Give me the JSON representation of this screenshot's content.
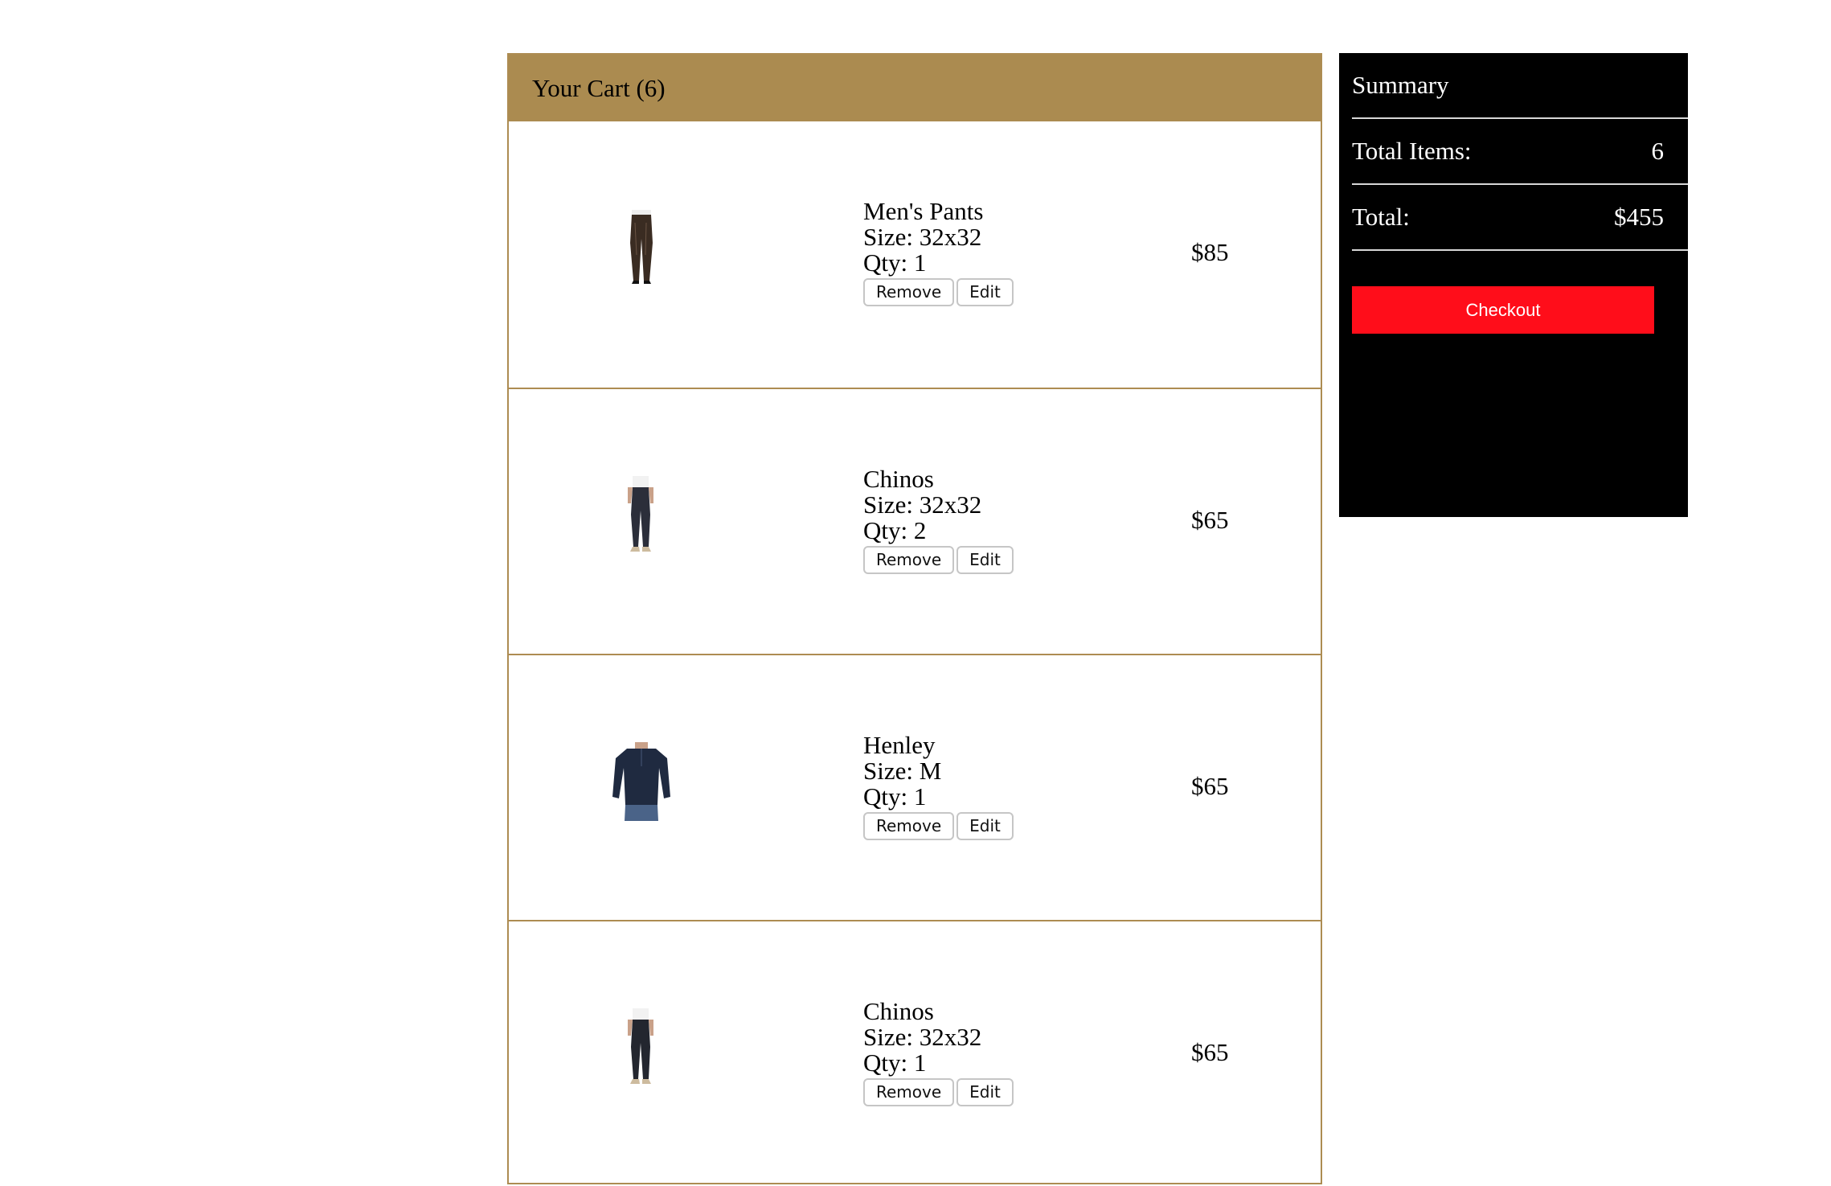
{
  "cart": {
    "title": "Your Cart (6)",
    "border_color": "#ad8c52",
    "header_color": "#ab8b50",
    "items": [
      {
        "name": "Men's Pants",
        "size": "Size: 32x32",
        "qty": "Qty: 1",
        "price": "$85",
        "remove_label": "Remove",
        "edit_label": "Edit",
        "image_icon": "leather-pants-image"
      },
      {
        "name": "Chinos",
        "size": "Size: 32x32",
        "qty": "Qty: 2",
        "price": "$65",
        "remove_label": "Remove",
        "edit_label": "Edit",
        "image_icon": "chinos-image"
      },
      {
        "name": "Henley",
        "size": "Size: M",
        "qty": "Qty: 1",
        "price": "$65",
        "remove_label": "Remove",
        "edit_label": "Edit",
        "image_icon": "henley-shirt-image"
      },
      {
        "name": "Chinos",
        "size": "Size: 32x32",
        "qty": "Qty: 1",
        "price": "$65",
        "remove_label": "Remove",
        "edit_label": "Edit",
        "image_icon": "chinos-image"
      }
    ]
  },
  "summary": {
    "title": "Summary",
    "total_items_label": "Total Items:",
    "total_items_value": "6",
    "total_label": "Total:",
    "total_value": "$455",
    "checkout_label": "Checkout",
    "background_color": "#000000",
    "checkout_color": "#ff0d1a"
  }
}
